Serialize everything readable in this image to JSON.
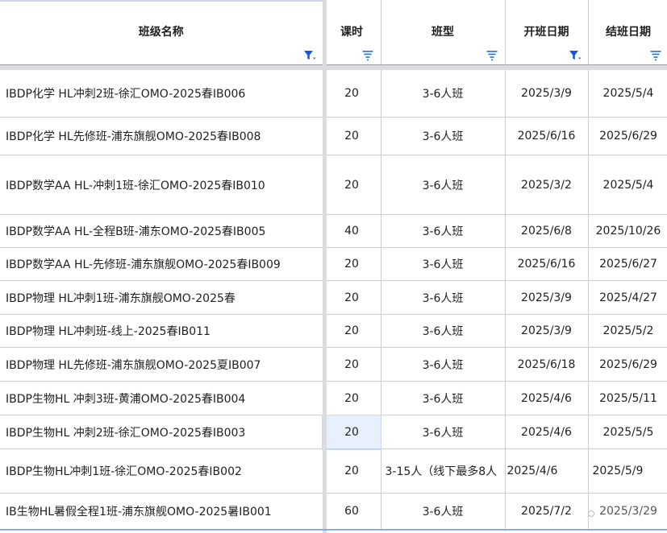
{
  "headers": [
    {
      "label": "班级名称",
      "filter_active": true
    },
    {
      "label": "课时",
      "filter_active": false
    },
    {
      "label": "班型",
      "filter_active": false
    },
    {
      "label": "开班日期",
      "filter_active": true
    },
    {
      "label": "结班日期",
      "filter_active": false
    }
  ],
  "rows": [
    {
      "name": "IBDP化学 HL冲刺2班-徐汇OMO-2025春IB006",
      "hours": "20",
      "type": "3-6人班",
      "start": "2025/3/9",
      "end": "2025/5/4"
    },
    {
      "name": "IBDP化学 HL先修班-浦东旗舰OMO-2025春IB008",
      "hours": "20",
      "type": "3-6人班",
      "start": "2025/6/16",
      "end": "2025/6/29"
    },
    {
      "name": "IBDP数学AA HL-冲刺1班-徐汇OMO-2025春IB010",
      "hours": "20",
      "type": "3-6人班",
      "start": "2025/3/2",
      "end": "2025/5/4"
    },
    {
      "name": "IBDP数学AA HL-全程B班-浦东OMO-2025春IB005",
      "hours": "40",
      "type": "3-6人班",
      "start": "2025/6/8",
      "end": "2025/10/26"
    },
    {
      "name": "IBDP数学AA HL-先修班-浦东旗舰OMO-2025春IB009",
      "hours": "20",
      "type": "3-6人班",
      "start": "2025/6/16",
      "end": "2025/6/27"
    },
    {
      "name": "IBDP物理 HL冲刺1班-浦东旗舰OMO-2025春",
      "hours": "20",
      "type": "3-6人班",
      "start": "2025/3/9",
      "end": "2025/4/27"
    },
    {
      "name": "IBDP物理 HL冲刺班-线上-2025春IB011",
      "hours": "20",
      "type": "3-6人班",
      "start": "2025/3/9",
      "end": "2025/5/2"
    },
    {
      "name": "IBDP物理 HL先修班-浦东旗舰OMO-2025夏IB007",
      "hours": "20",
      "type": "3-6人班",
      "start": "2025/6/18",
      "end": "2025/6/29"
    },
    {
      "name": "IBDP生物HL 冲刺3班-黄浦OMO-2025春IB004",
      "hours": "20",
      "type": "3-6人班",
      "start": "2025/4/6",
      "end": "2025/5/11"
    },
    {
      "name": "IBDP生物HL 冲刺2班-徐汇OMO-2025春IB003",
      "hours": "20",
      "type": "3-6人班",
      "start": "2025/4/6",
      "end": "2025/5/5"
    },
    {
      "name": "IBDP生物HL冲刺1班-徐汇OMO-2025春IB002",
      "hours": "20",
      "type": "3-15人（线下最多8人",
      "start": "2025/4/6",
      "end": "2025/5/9"
    },
    {
      "name": "IB生物HL暑假全程1班-浦东旗舰OMO-2025暑IB001",
      "hours": "60",
      "type": "3-6人班",
      "start": "2025/7/2",
      "end": "2025/3/29"
    }
  ],
  "colors": {
    "filter_active": "#1a56db",
    "filter_inactive": "#1a73e8",
    "selected": "#e8f0fe"
  }
}
